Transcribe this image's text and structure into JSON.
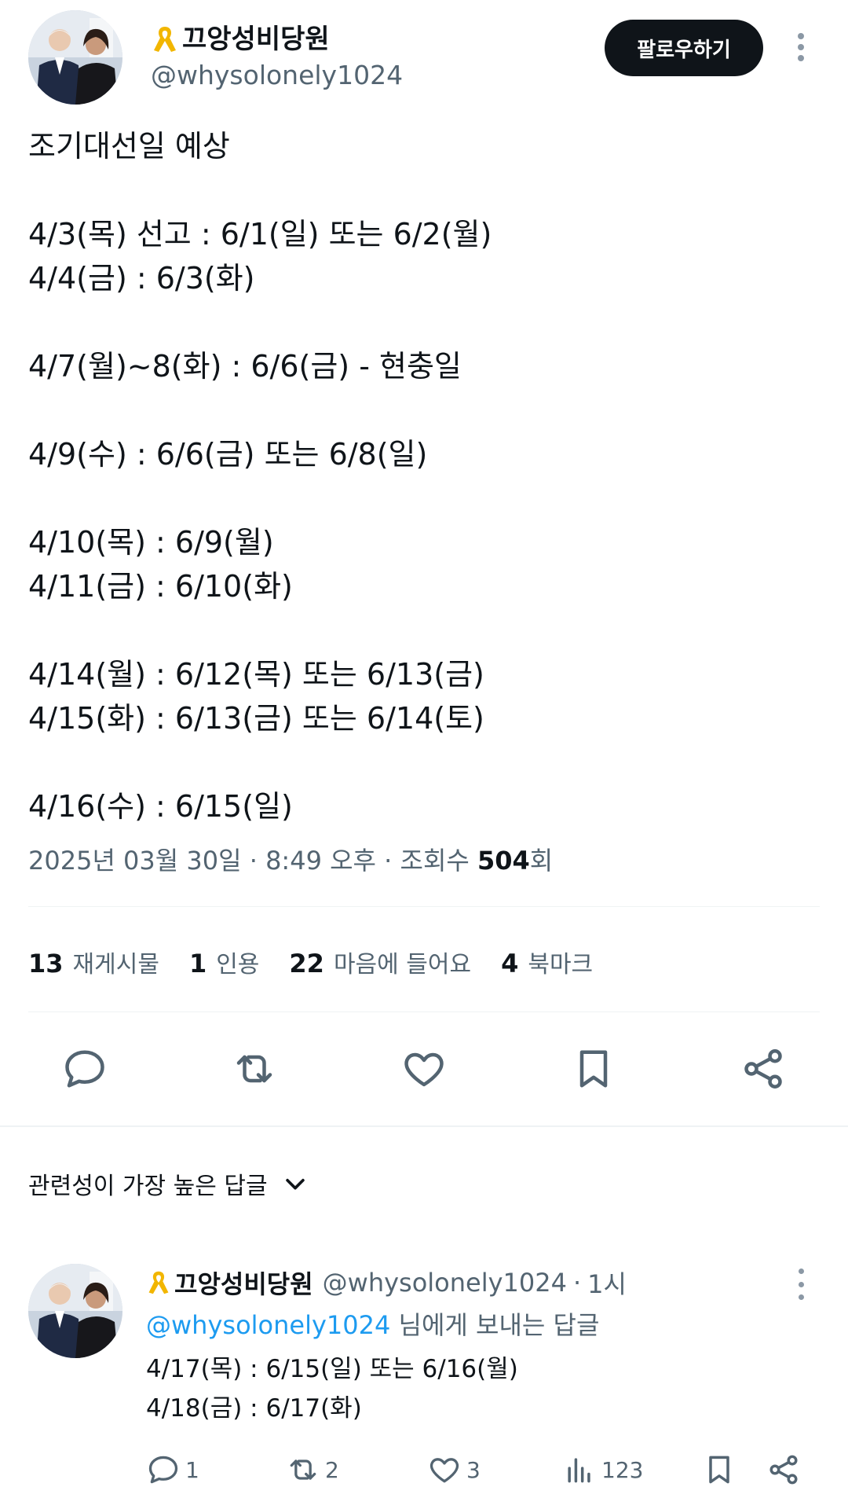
{
  "colors": {
    "text": "#0f1419",
    "secondary": "#536471",
    "accent": "#1d9bf0",
    "follow_bg": "#0f1419",
    "ribbon": "#f2b600"
  },
  "author": {
    "display_name": "끄앙성비당원",
    "handle": "@whysolonely1024",
    "badge_icon": "yellow-ribbon-icon"
  },
  "header": {
    "follow_label": "팔로우하기",
    "more_icon": "more-vertical-icon"
  },
  "tweet": {
    "lines": [
      "조기대선일 예상",
      "",
      "4/3(목) 선고 : 6/1(일) 또는 6/2(월)",
      "4/4(금) : 6/3(화)",
      "",
      "4/7(월)~8(화) : 6/6(금) - 현충일",
      "",
      "4/9(수) : 6/6(금) 또는 6/8(일)",
      "",
      "4/10(목) : 6/9(월)",
      "4/11(금) : 6/10(화)",
      "",
      "4/14(월) : 6/12(목) 또는 6/13(금)",
      "4/15(화) : 6/13(금) 또는 6/14(토)",
      "",
      "4/16(수) : 6/15(일)"
    ],
    "date": "2025년 03월 30일",
    "time": "8:49 오후",
    "views_label": "조회수",
    "views_count": "504",
    "views_suffix": "회",
    "separator": "·"
  },
  "stats": {
    "reposts_count": "13",
    "reposts_label": "재게시물",
    "quotes_count": "1",
    "quotes_label": "인용",
    "likes_count": "22",
    "likes_label": "마음에 들어요",
    "bookmarks_count": "4",
    "bookmarks_label": "북마크"
  },
  "actions": {
    "icons": [
      "reply-icon",
      "repost-icon",
      "like-icon",
      "bookmark-icon",
      "share-icon"
    ]
  },
  "replies_sort": {
    "label": "관련성이 가장 높은 답글",
    "icon": "chevron-down-icon"
  },
  "reply": {
    "display_name": "끄앙성비당원",
    "handle": "@whysolonely1024",
    "time": "1시",
    "dot": "·",
    "replying_to": "@whysolonely1024",
    "replying_suffix": "님에게 보내는 답글",
    "lines": [
      "4/17(목) : 6/15(일) 또는 6/16(월)",
      "4/18(금) : 6/17(화)"
    ],
    "reply_count": "1",
    "repost_count": "2",
    "like_count": "3",
    "view_count": "123"
  }
}
